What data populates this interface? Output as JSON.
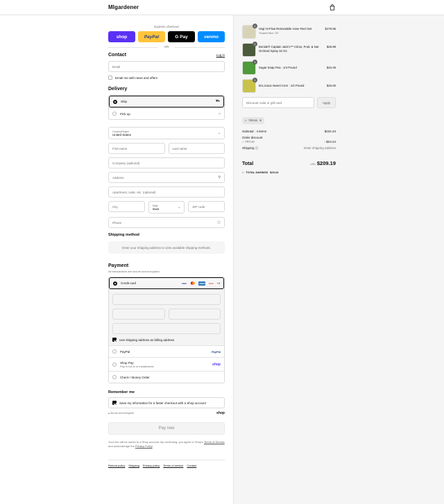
{
  "header": {
    "logo": "MIgardener"
  },
  "express": {
    "label": "Express checkout",
    "buttons": [
      {
        "label": "shop",
        "bg": "#5a31f4",
        "fg": "#ffffff"
      },
      {
        "label": "PayPal",
        "bg": "#ffc439",
        "fg": "#253b80"
      },
      {
        "label": "G Pay",
        "bg": "#000000",
        "fg": "#ffffff"
      },
      {
        "label": "venmo",
        "bg": "#008cff",
        "fg": "#ffffff"
      }
    ],
    "or": "OR"
  },
  "contact": {
    "title": "Contact",
    "login": "Log in",
    "email_placeholder": "Email",
    "newsletter": "Email me with news and offers"
  },
  "delivery": {
    "title": "Delivery",
    "ship": "Ship",
    "pickup": "Pick up",
    "country_label": "Country/Region",
    "country_value": "United States",
    "first_name": "First name",
    "last_name": "Last name",
    "company": "Company (optional)",
    "address": "Address",
    "apartment": "Apartment, suite, etc. (optional)",
    "city": "City",
    "state_label": "State",
    "state_value": "Iowa",
    "zip": "ZIP code",
    "phone": "Phone"
  },
  "shipping_method": {
    "title": "Shipping method",
    "message": "Enter your shipping address to view available shipping methods."
  },
  "payment": {
    "title": "Payment",
    "subtitle": "All transactions are secure and encrypted.",
    "credit_card": "Credit card",
    "cards": [
      {
        "label": "VISA",
        "bg": "#ffffff",
        "fg": "#1a1f71"
      },
      {
        "label": "MC",
        "bg": "#ffffff",
        "fg": "#eb001b"
      },
      {
        "label": "AMEX",
        "bg": "#2e77bb",
        "fg": "#ffffff"
      },
      {
        "label": "DISC",
        "bg": "#ffffff",
        "fg": "#e55c20"
      }
    ],
    "more_cards": "+3",
    "billing_same": "Use shipping address as billing address",
    "paypal": "PayPal",
    "paypal_logo": "PayPal",
    "shop_pay": "Shop Pay",
    "shop_pay_sub": "Pay in full or in installments",
    "shop_pay_logo": "shop",
    "check": "Check / Money Order"
  },
  "remember": {
    "title": "Remember me",
    "save": "Save my information for a faster checkout with a Shop account",
    "secure": "Secure and encrypted",
    "shop_logo": "shop"
  },
  "pay_now": "Pay now",
  "legal": {
    "text": "Your info will be saved to a Shop account. By continuing, you agree to Shop's",
    "terms": "Terms of Service",
    "and": "and acknowledge the",
    "privacy": "Privacy Policy",
    "end": "."
  },
  "footer": [
    "Refund policy",
    "Shipping",
    "Privacy policy",
    "Terms of service",
    "Contact"
  ],
  "cart": {
    "items": [
      {
        "name": "Vegi Hi-Flow Retractable Hose Reel Set",
        "variant": "Tempest Blue / 50'",
        "price": "$179.95",
        "qty": "1",
        "color": "#d8d3b8"
      },
      {
        "name": "Bonide® Captain Jack's™ Citrus, Fruit, & Nut Orchard Spray 32 Oz.",
        "variant": "",
        "price": "$26.99",
        "qty": "1",
        "color": "#4a5a3a"
      },
      {
        "name": "Sugar Snap Pea : 1/4 Pound",
        "variant": "",
        "price": "$10.49",
        "qty": "1",
        "color": "#4f9a3a"
      },
      {
        "name": "Bi-Licious Sweet Corn : 1/4 Pound",
        "variant": "",
        "price": "$15.00",
        "qty": "1",
        "color": "#c9c24a"
      }
    ],
    "discount_placeholder": "Discount code or gift card",
    "apply": "Apply",
    "code": "TRY10",
    "subtotal_label": "Subtotal · 4 items",
    "subtotal": "$232.43",
    "order_discount": "Order discount",
    "discount_code": "TRY10",
    "discount_amount": "- $23.24",
    "shipping_label": "Shipping",
    "shipping_value": "Enter shipping address",
    "total_label": "Total",
    "currency": "USD",
    "total": "$209.19",
    "savings_label": "TOTAL SAVINGS",
    "savings": "$23.24"
  }
}
